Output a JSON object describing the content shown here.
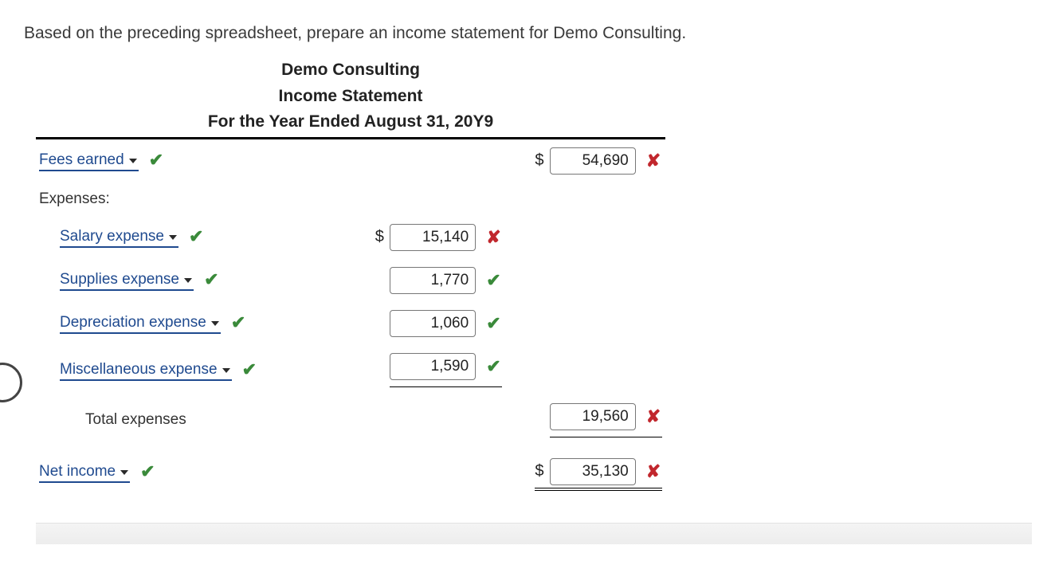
{
  "prompt": "Based on the preceding spreadsheet, prepare an income statement for Demo Consulting.",
  "heading": {
    "company": "Demo Consulting",
    "title": "Income Statement",
    "period": "For the Year Ended August 31, 20Y9"
  },
  "labels": {
    "fees_earned": "Fees earned",
    "expenses": "Expenses:",
    "salary": "Salary expense",
    "supplies": "Supplies expense",
    "depreciation": "Depreciation expense",
    "misc": "Miscellaneous expense",
    "total_exp": "Total expenses",
    "net_income": "Net income"
  },
  "values": {
    "fees_earned": "54,690",
    "salary": "15,140",
    "supplies": "1,770",
    "depreciation": "1,060",
    "misc": "1,590",
    "total_exp": "19,560",
    "net_income": "35,130"
  },
  "marks": {
    "fees_earned_label": "correct",
    "fees_earned_value": "wrong",
    "salary_label": "correct",
    "salary_value": "wrong",
    "supplies_label": "correct",
    "supplies_value": "correct",
    "depreciation_label": "correct",
    "depreciation_value": "correct",
    "misc_label": "correct",
    "misc_value": "correct",
    "total_exp_value": "wrong",
    "net_income_label": "correct",
    "net_income_value": "wrong"
  },
  "glyphs": {
    "correct": "✔",
    "wrong": "✘",
    "dollar": "$"
  }
}
